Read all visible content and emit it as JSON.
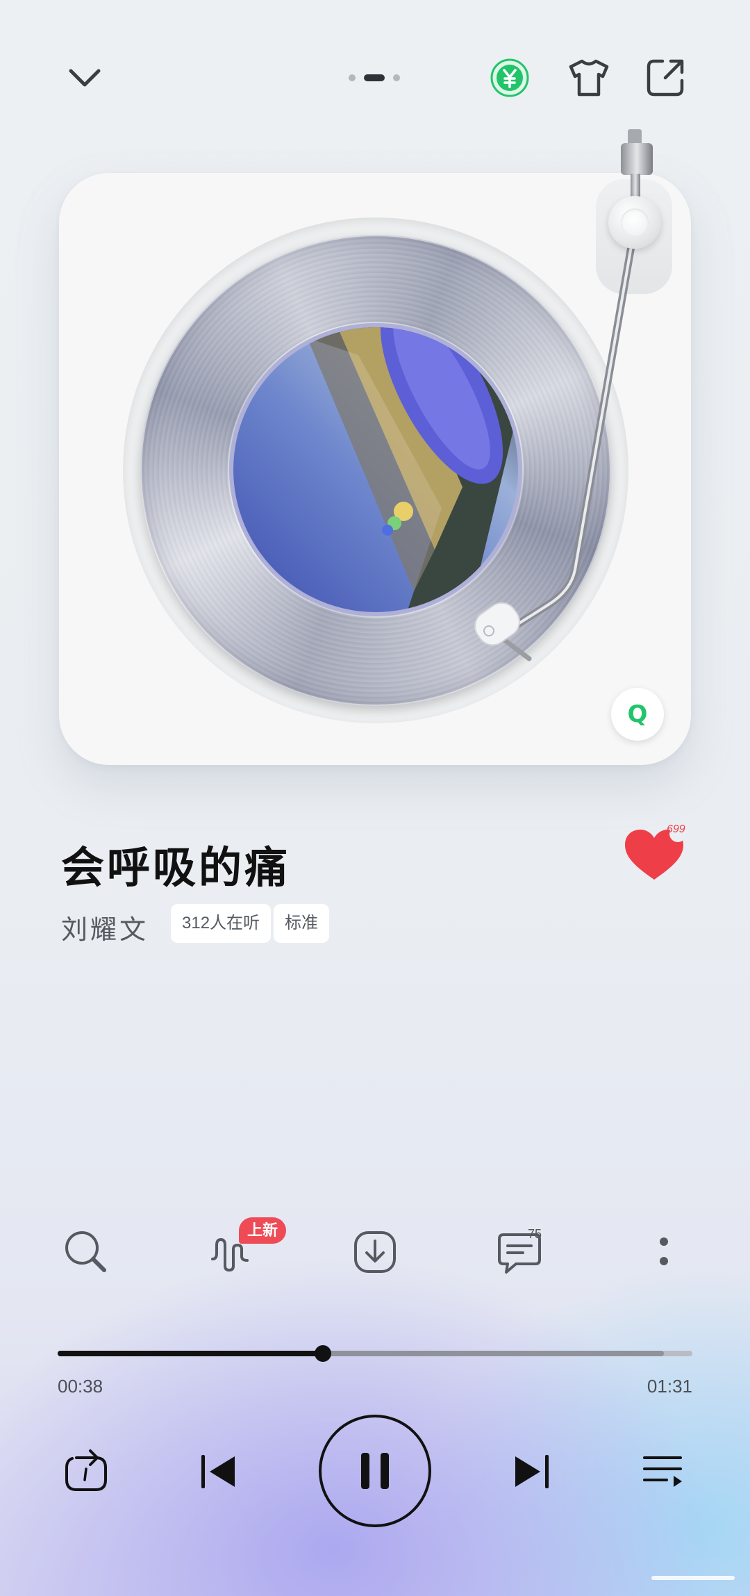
{
  "header": {
    "collapse_icon": "chevron-down-icon",
    "vip_icon": "yen-circle-icon",
    "skin_icon": "tshirt-icon",
    "share_icon": "share-icon",
    "page_indicator": {
      "count": 3,
      "active": 1
    }
  },
  "player": {
    "source_badge": "Q",
    "song_title": "会呼吸的痛",
    "artist": "刘耀文",
    "listeners_tag": "312人在听",
    "quality_tag": "标准",
    "like_count": "699"
  },
  "actions": {
    "search_icon": "search-icon",
    "sound_effect_icon": "waveform-icon",
    "sound_effect_badge": "上新",
    "download_icon": "download-icon",
    "comment_icon": "comment-icon",
    "comment_count": "75",
    "more_icon": "more-vertical-icon"
  },
  "progress": {
    "current_time": "00:38",
    "total_time": "01:31",
    "played_fraction": 0.418,
    "buffered_fraction": 0.955
  },
  "controls": {
    "loop_icon": "repeat-one-icon",
    "prev_icon": "previous-icon",
    "play_pause_icon": "pause-icon",
    "next_icon": "next-icon",
    "playlist_icon": "playlist-icon"
  },
  "colors": {
    "accent_green": "#22c46a",
    "like_red": "#ee3e48",
    "badge_red": "#ee4b56",
    "text_dark": "#111111"
  }
}
